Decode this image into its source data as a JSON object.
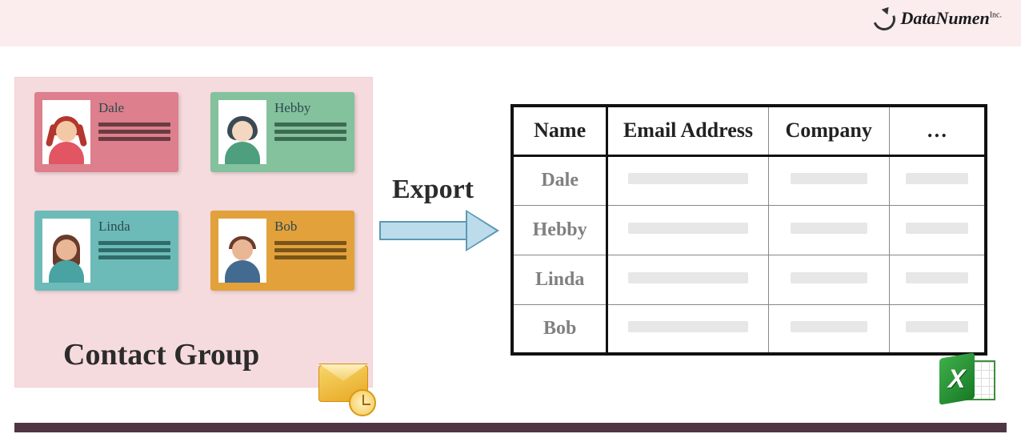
{
  "brand": {
    "name": "DataNumen",
    "suffix": "Inc."
  },
  "contact_group": {
    "title": "Contact Group",
    "cards": [
      {
        "name": "Dale"
      },
      {
        "name": "Hebby"
      },
      {
        "name": "Linda"
      },
      {
        "name": "Bob"
      }
    ]
  },
  "arrow": {
    "label": "Export"
  },
  "table": {
    "headers": {
      "name": "Name",
      "email": "Email Address",
      "company": "Company",
      "more": "…"
    },
    "rows": [
      {
        "name": "Dale"
      },
      {
        "name": "Hebby"
      },
      {
        "name": "Linda"
      },
      {
        "name": "Bob"
      }
    ]
  },
  "icons": {
    "outlook": "outlook-icon",
    "excel": "excel-icon",
    "excel_letter": "X"
  }
}
